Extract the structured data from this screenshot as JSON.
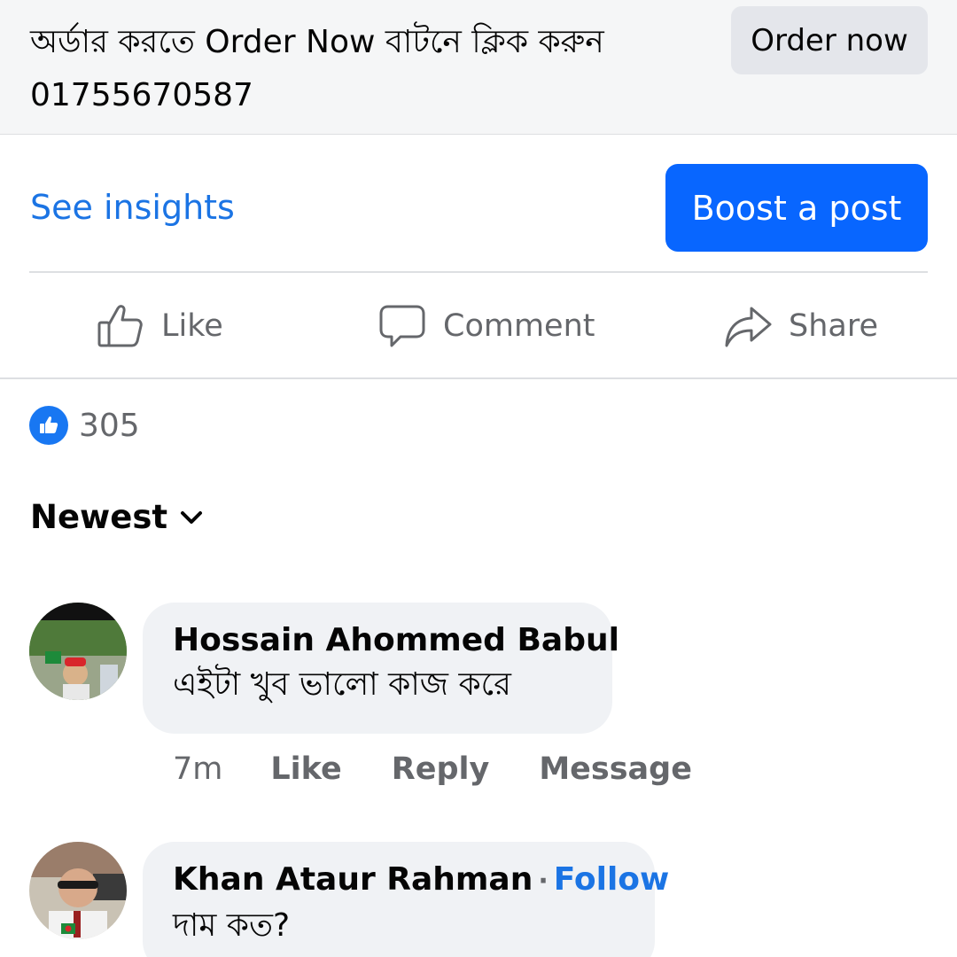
{
  "post_header": {
    "text_line1": "অর্ডার করতে Order Now বাটনে ক্লিক করুন",
    "text_line2": "01755670587",
    "order_button_label": "Order now"
  },
  "insights": {
    "see_insights_label": "See insights",
    "boost_label": "Boost a post"
  },
  "actions": {
    "like_label": "Like",
    "comment_label": "Comment",
    "share_label": "Share"
  },
  "reactions": {
    "count": "305"
  },
  "sort": {
    "label": "Newest"
  },
  "comments": [
    {
      "author": "Hossain Ahommed Babul",
      "text": "এইটা খুব ভালো কাজ করে",
      "time": "7m",
      "like_label": "Like",
      "reply_label": "Reply",
      "message_label": "Message"
    },
    {
      "author": "Khan Ataur Rahman",
      "separator": "·",
      "follow_label": "Follow",
      "text": "দাম কত?"
    }
  ],
  "colors": {
    "primary_blue": "#0866ff",
    "link_blue": "#1b74e4",
    "muted_gray": "#65676b",
    "bubble_bg": "#f0f2f5"
  }
}
